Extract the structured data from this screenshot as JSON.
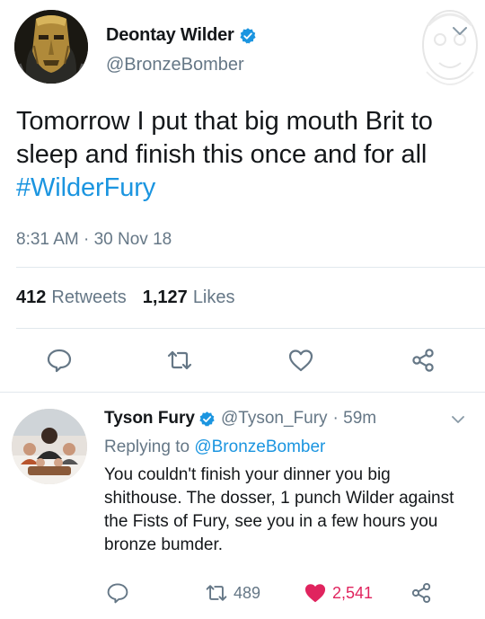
{
  "main_tweet": {
    "author_name": "Deontay Wilder",
    "handle": "@BronzeBomber",
    "text_before": "Tomorrow I put that big mouth Brit to sleep and finish this once and for all ",
    "hashtag": "#WilderFury",
    "timestamp": "8:31 AM · 30 Nov 18",
    "retweet_count": "412",
    "retweet_label": "Retweets",
    "like_count": "1,127",
    "like_label": "Likes",
    "verified": true
  },
  "reply_tweet": {
    "author_name": "Tyson Fury",
    "handle": "@Tyson_Fury",
    "time_ago": "· 59m",
    "replying_prefix": "Replying to",
    "replying_to": "@BronzeBomber",
    "text": "You couldn't finish your dinner you big shithouse. The dosser, 1 punch Wilder against the Fists of Fury, see you in a few hours you bronze bumder.",
    "retweet_count": "489",
    "like_count": "2,541",
    "liked": true,
    "verified": true
  },
  "icons": {
    "reply": "reply-icon",
    "retweet": "retweet-icon",
    "like": "heart-icon",
    "share": "share-icon",
    "more": "chevron-down-icon",
    "verified": "verified-badge-icon"
  },
  "colors": {
    "accent": "#1b95e0",
    "secondary_text": "#657786",
    "like_red": "#e0245e",
    "divider": "#e1e8ed"
  }
}
